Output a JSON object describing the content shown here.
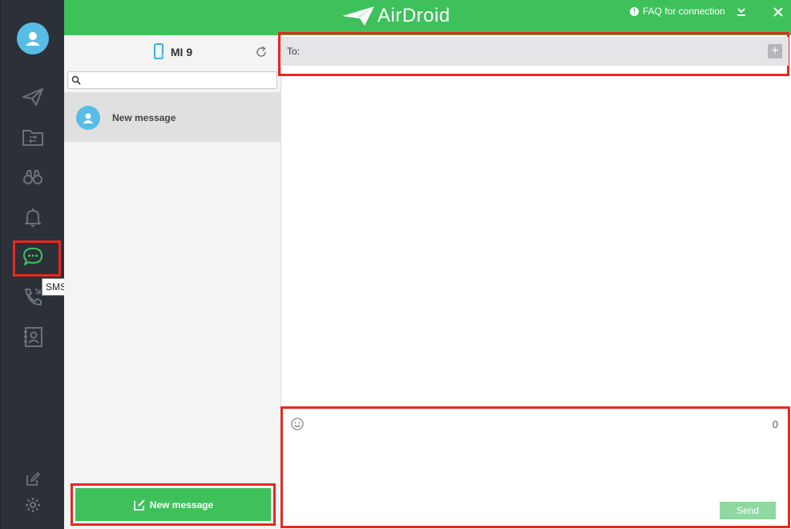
{
  "app": {
    "logo_text": "AirDroid",
    "accent": "#3ec15b"
  },
  "topbar": {
    "faq_label": "FAQ for connection"
  },
  "rail": {
    "tooltip": "SMS",
    "items": [
      "send-icon",
      "files-icon",
      "binoculars-icon",
      "notification-icon",
      "sms-icon",
      "calls-icon",
      "contacts-icon"
    ],
    "bottom": [
      "feedback-icon",
      "settings-icon"
    ]
  },
  "listpane": {
    "device_name": "MI 9",
    "search_placeholder": "",
    "conversations": [
      {
        "label": "New message"
      }
    ],
    "new_message_label": "New message"
  },
  "chat": {
    "to_label": "To:",
    "char_count": "0",
    "send_label": "Send"
  }
}
